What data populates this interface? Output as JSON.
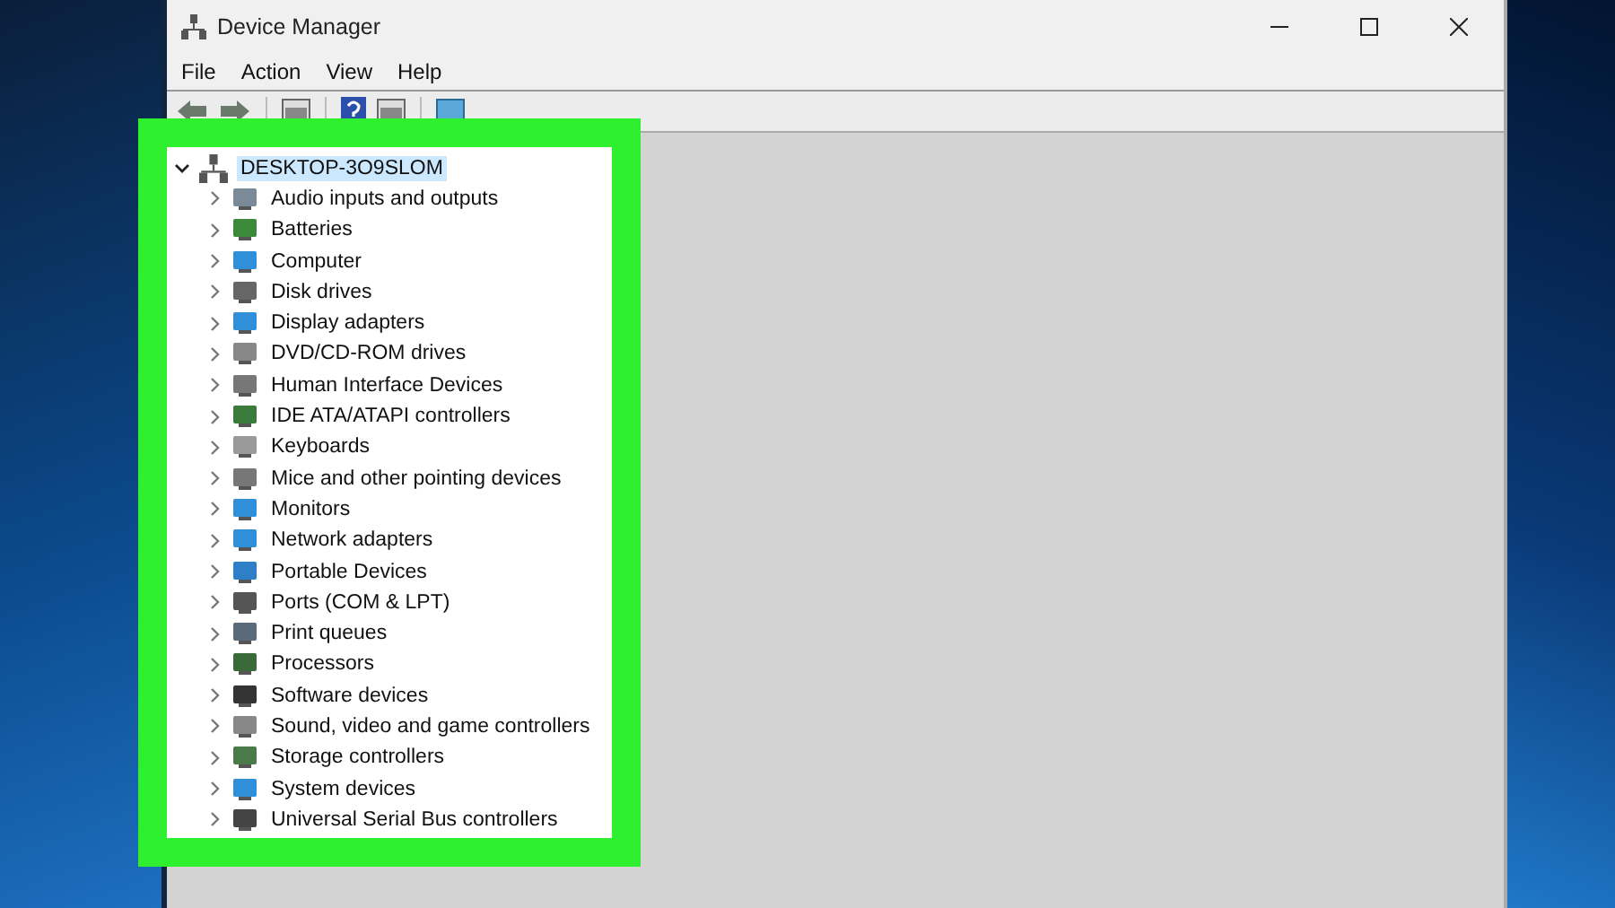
{
  "window": {
    "title": "Device Manager"
  },
  "menu": [
    "File",
    "Action",
    "View",
    "Help"
  ],
  "tree": {
    "label": "DESKTOP-3O9SLOM",
    "expanded": true,
    "selected": true,
    "children": [
      {
        "label": "Audio inputs and outputs",
        "expanded": false
      },
      {
        "label": "Batteries",
        "expanded": false
      },
      {
        "label": "Computer",
        "expanded": false
      },
      {
        "label": "Disk drives",
        "expanded": false
      },
      {
        "label": "Display adapters",
        "expanded": false
      },
      {
        "label": "DVD/CD-ROM drives",
        "expanded": false
      },
      {
        "label": "Human Interface Devices",
        "expanded": false
      },
      {
        "label": "IDE ATA/ATAPI controllers",
        "expanded": false
      },
      {
        "label": "Keyboards",
        "expanded": false
      },
      {
        "label": "Mice and other pointing devices",
        "expanded": false
      },
      {
        "label": "Monitors",
        "expanded": false
      },
      {
        "label": "Network adapters",
        "expanded": false
      },
      {
        "label": "Portable Devices",
        "expanded": false
      },
      {
        "label": "Ports (COM & LPT)",
        "expanded": false
      },
      {
        "label": "Print queues",
        "expanded": false
      },
      {
        "label": "Processors",
        "expanded": false
      },
      {
        "label": "Software devices",
        "expanded": false
      },
      {
        "label": "Sound, video and game controllers",
        "expanded": false
      },
      {
        "label": "Storage controllers",
        "expanded": false
      },
      {
        "label": "System devices",
        "expanded": false
      },
      {
        "label": "Universal Serial Bus controllers",
        "expanded": false
      }
    ]
  }
}
